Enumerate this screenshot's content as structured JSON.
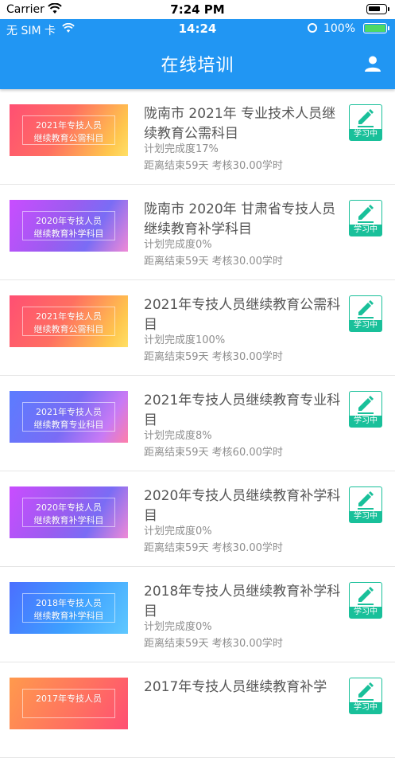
{
  "device_status": {
    "carrier": "Carrier",
    "time": "7:24 PM"
  },
  "app_status": {
    "sim": "无 SIM 卡",
    "time": "14:24",
    "battery": "100%",
    "battery_color": "#4cd964"
  },
  "header": {
    "title": "在线培训",
    "background": "#2196f3",
    "right_icon": "user-icon"
  },
  "badge_label": "学习中",
  "accent_color": "#19c09a",
  "courses": [
    {
      "banner_line1": "2021年专技人员",
      "banner_line2": "继续教育公需科目",
      "title": "陇南市 2021年 专业技术人员继续教育公需科目",
      "progress": "计划完成度17%",
      "deadline": "距离结束59天 考核30.00学时"
    },
    {
      "banner_line1": "2020年专技人员",
      "banner_line2": "继续教育补学科目",
      "title": "陇南市 2020年 甘肃省专技人员继续教育补学科目",
      "progress": "计划完成度0%",
      "deadline": "距离结束59天 考核30.00学时"
    },
    {
      "banner_line1": "2021年专技人员",
      "banner_line2": "继续教育公需科目",
      "title": "2021年专技人员继续教育公需科目",
      "progress": "计划完成度100%",
      "deadline": "距离结束59天 考核30.00学时"
    },
    {
      "banner_line1": "2021年专技人员",
      "banner_line2": "继续教育专业科目",
      "title": "2021年专技人员继续教育专业科目",
      "progress": "计划完成度8%",
      "deadline": "距离结束59天 考核60.00学时"
    },
    {
      "banner_line1": "2020年专技人员",
      "banner_line2": "继续教育补学科目",
      "title": "2020年专技人员继续教育补学科目",
      "progress": "计划完成度0%",
      "deadline": "距离结束59天 考核30.00学时"
    },
    {
      "banner_line1": "2018年专技人员",
      "banner_line2": "继续教育补学科目",
      "title": "2018年专技人员继续教育补学科目",
      "progress": "计划完成度0%",
      "deadline": "距离结束59天 考核30.00学时"
    },
    {
      "banner_line1": "2017年专技人员",
      "banner_line2": "",
      "title": "2017年专技人员继续教育补学",
      "progress": "",
      "deadline": ""
    }
  ]
}
